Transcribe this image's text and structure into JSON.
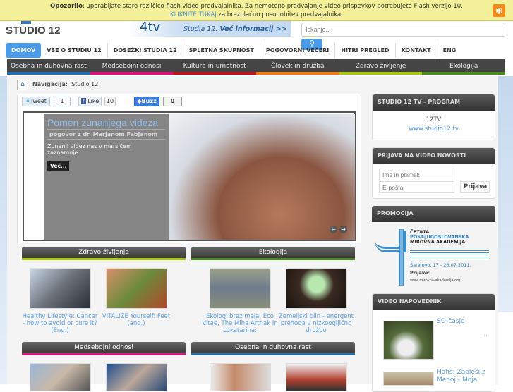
{
  "flash_warning": {
    "label": "Opozorilo",
    "text": ": uporabljate staro različico flash video predvajalnika. Za nemoteno predvajanje video prispevkov potrebujete Flash verzijo 10.",
    "link": "KLIKNITE TUKAJ",
    "link_suffix": " za brezplačno posodobitev predvajalnika."
  },
  "logo": "STUDIO 12",
  "banner": {
    "tv": "4tv",
    "line1": "Studia 12.",
    "cta": "Več informacij >>"
  },
  "search": {
    "placeholder": "Iskanje...",
    "button_icon": "search-icon"
  },
  "nav": [
    "DOMOV",
    "VSE O STUDIU 12",
    "DOSEŽKI STUDIA 12",
    "SPLETNA SKUPNOST",
    "POGOVORNI VEČERI",
    "HITRI PREGLED",
    "KONTAKT",
    "ENG"
  ],
  "categories": [
    {
      "label": "Osebna in duhovna rast",
      "color": "#1a6fb5"
    },
    {
      "label": "Medsebojni odnosi",
      "color": "#e0107a"
    },
    {
      "label": "Kultura in umetnost",
      "color": "#c0141c"
    },
    {
      "label": "Človek in družba",
      "color": "#f07c10"
    },
    {
      "label": "Zdravo življenje",
      "color": "#a8c80a"
    },
    {
      "label": "Ekologija",
      "color": "#4a8c1a"
    }
  ],
  "breadcrumb": {
    "label": "Navigacija:",
    "current": "Studio 12"
  },
  "social": {
    "tweet": "Tweet",
    "tweet_count": "1",
    "like": "Like",
    "like_count": "10",
    "buzz": "Buzz",
    "buzz_count": "0"
  },
  "slide": {
    "title": "Pomen zunanjega videza",
    "subtitle": "pogovor z dr. Marjanom Fabjanom",
    "desc": "Zunanji videz nas v marsičem zaznamuje.",
    "more": "Več..."
  },
  "sections": [
    {
      "title": "Zdravo življenje",
      "items": [
        "Healthy Lifestyle: Cancer - how to avoid or cure it? (Eng.)",
        "VITALIZE Yourself: Feet (ang.)"
      ]
    },
    {
      "title": "Ekologija",
      "items": [
        "Ekologi brez meja, Eco Vitae, The Miha Artnak in Lukatarina:",
        "Zemeljski plin - energent prehoda v nizkoogljično družbo"
      ]
    },
    {
      "title": "Medsebojni odnosi",
      "items": []
    },
    {
      "title": "Osebna in duhovna rast",
      "items": []
    }
  ],
  "sidebar": {
    "program": {
      "title": "STUDIO 12 TV - PROGRAM",
      "name": "12TV",
      "link": "www.studio12.tv"
    },
    "newsletter": {
      "title": "PRIJAVA NA VIDEO NOVOSTI",
      "name_placeholder": "Ime in priimek",
      "email_placeholder": "E-pošta",
      "submit": "Prijava"
    },
    "promo": {
      "title": "PROMOCIJA",
      "l1": "ČETRTA",
      "l2": "POST-JUGOSLOVANSKA",
      "l3": "MIROVNA AKADEMIJA",
      "date": "Sarajevo, 17 - 26.07.2011.",
      "apply": "Prijave:",
      "url": "www.mirovna-akademija.org"
    },
    "videos": {
      "title": "VIDEO NAPOVEDNIK",
      "items": [
        "SO-časje",
        "Hafis: Zapleši z Menoj - Moja"
      ],
      "more": "..."
    }
  }
}
